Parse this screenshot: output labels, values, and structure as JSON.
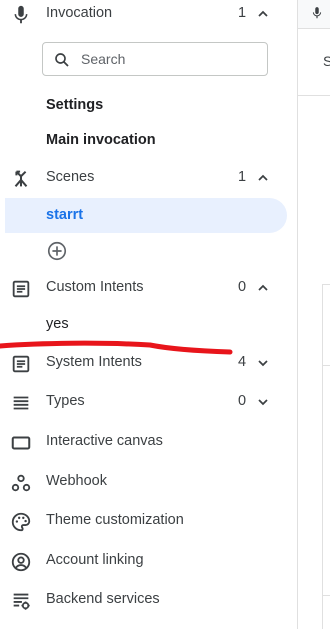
{
  "sidebar": {
    "invocation": {
      "label": "Invocation",
      "count": "1"
    },
    "search": {
      "placeholder": "Search"
    },
    "invocation_items": [
      "Settings",
      "Main invocation"
    ],
    "scenes": {
      "label": "Scenes",
      "count": "1",
      "items": [
        "starrt"
      ]
    },
    "custom_intents": {
      "label": "Custom Intents",
      "count": "0",
      "items": [
        "yes"
      ]
    },
    "system_intents": {
      "label": "System Intents",
      "count": "4"
    },
    "types": {
      "label": "Types",
      "count": "0"
    },
    "links": [
      {
        "label": "Interactive canvas",
        "icon": "interactive-canvas-icon"
      },
      {
        "label": "Webhook",
        "icon": "webhook-icon"
      },
      {
        "label": "Theme customization",
        "icon": "palette-icon"
      },
      {
        "label": "Account linking",
        "icon": "account-circle-icon"
      },
      {
        "label": "Backend services",
        "icon": "backend-services-icon"
      }
    ]
  },
  "right_pane": {
    "heading_initial": "S"
  },
  "colors": {
    "accent": "#1a73e8",
    "selected_bg": "#e8f0fe",
    "annotation_red": "#e8151b",
    "text": "#3c4043"
  }
}
